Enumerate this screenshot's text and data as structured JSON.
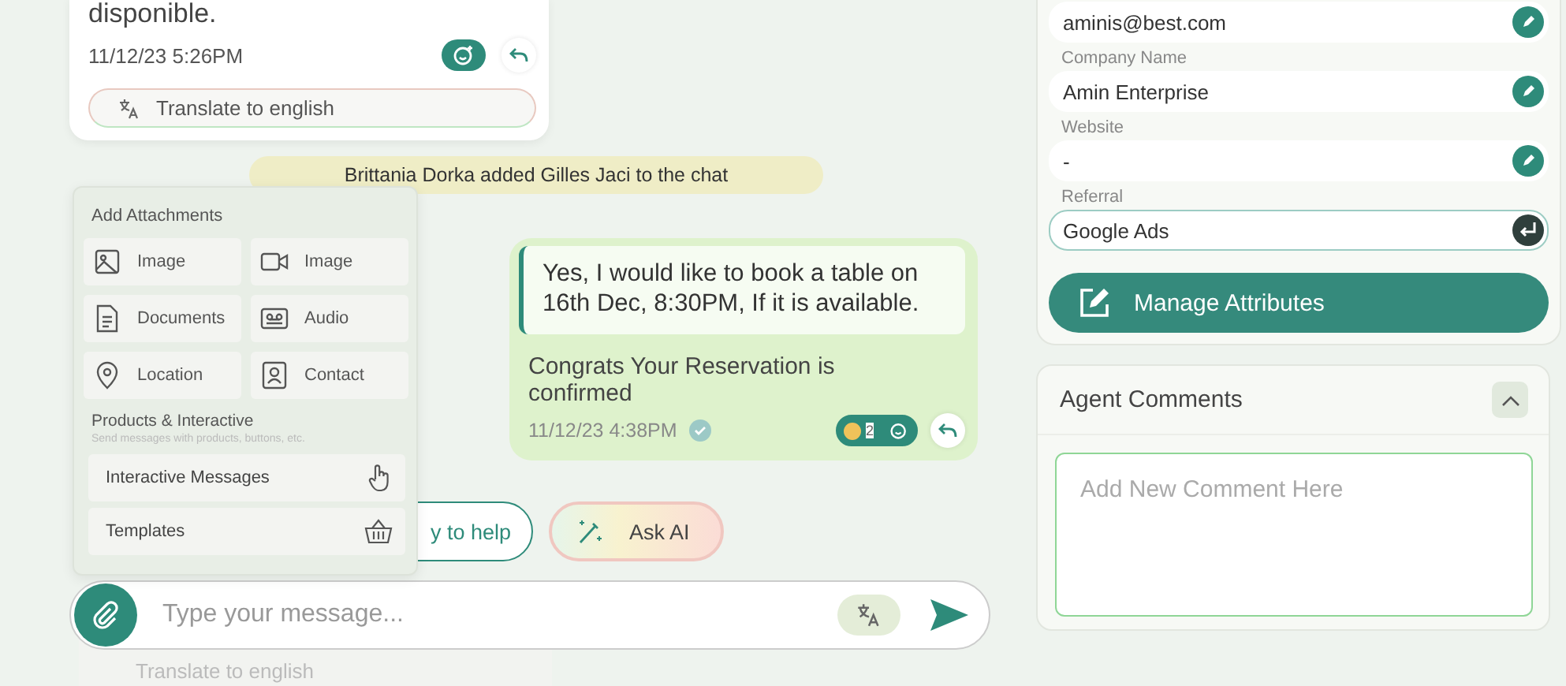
{
  "chat": {
    "incoming": {
      "text": "disponible.",
      "time": "11/12/23 5:26PM",
      "translate": "Translate to english"
    },
    "system_note": "Brittania Dorka added Gilles Jaci to the chat",
    "outgoing": {
      "quote": "Yes, I would like to book a table on 16th Dec, 8:30PM, If it is available.",
      "text": "Congrats Your Reservation is confirmed",
      "time": "11/12/23 4:38PM",
      "delivered": true,
      "reaction_count": "2"
    },
    "suggestions": [
      {
        "label": "y to help",
        "kind": "plain"
      },
      {
        "label": "Ask AI",
        "kind": "ai"
      }
    ],
    "composer": {
      "placeholder": "Type your message..."
    },
    "behind_translate": "Translate to english"
  },
  "attachments": {
    "title": "Add Attachments",
    "items": [
      {
        "label": "Image",
        "kind": "image"
      },
      {
        "label": "Image",
        "kind": "video"
      },
      {
        "label": "Documents",
        "kind": "document"
      },
      {
        "label": "Audio",
        "kind": "audio"
      },
      {
        "label": "Location",
        "kind": "location"
      },
      {
        "label": "Contact",
        "kind": "contact"
      }
    ],
    "section_title": "Products & Interactive",
    "section_hint": "Send messages with products, buttons, etc.",
    "section_items": [
      {
        "label": "Interactive Messages",
        "kind": "interactive"
      },
      {
        "label": "Templates",
        "kind": "template"
      }
    ]
  },
  "contact_panel": {
    "fields": [
      {
        "value": "aminis@best.com",
        "focused": false
      },
      {
        "label": "Company Name",
        "value": "Amin Enterprise",
        "focused": false
      },
      {
        "label": "Website",
        "value": "-",
        "focused": false
      },
      {
        "label": "Referral",
        "value": "Google Ads",
        "focused": true
      }
    ],
    "manage_button": "Manage Attributes"
  },
  "agent_comments": {
    "title": "Agent Comments",
    "expanded": true,
    "placeholder": "Add New Comment Here"
  }
}
